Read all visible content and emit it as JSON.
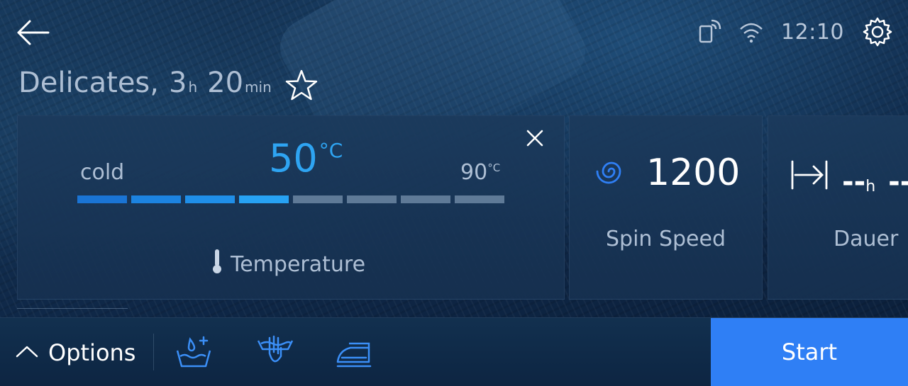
{
  "header": {
    "time": "12:10",
    "icons": [
      "back-arrow-icon",
      "remote-device-icon",
      "wifi-icon",
      "settings-gear-icon"
    ]
  },
  "program": {
    "name": "Delicates,",
    "hours": "3",
    "hours_unit": "h",
    "minutes": "20",
    "minutes_unit": "min",
    "favorite_icon": "star-outline-icon"
  },
  "temperature_card": {
    "value": "50",
    "unit": "°C",
    "min_label": "cold",
    "max_label": "90",
    "max_unit": "°C",
    "label": "Temperature",
    "level_fraction": 0.5,
    "segments_total": 8,
    "segments_active": 4,
    "colors": {
      "active": "#2ea4f2",
      "inactive": "#5f7a97"
    }
  },
  "spin_card": {
    "value": "1200",
    "label": "Spin Speed",
    "icon": "spin-spiral-icon"
  },
  "duration_card": {
    "value": "--",
    "unit": "h",
    "value2": "--",
    "label": "Dauer",
    "icon": "end-time-arrow-icon"
  },
  "bottom_bar": {
    "options_label": "Options",
    "option_icons": [
      "extra-water-icon",
      "hand-wash-icon",
      "iron-icon"
    ],
    "start_label": "Start",
    "start_color": "#2f7ff5"
  }
}
